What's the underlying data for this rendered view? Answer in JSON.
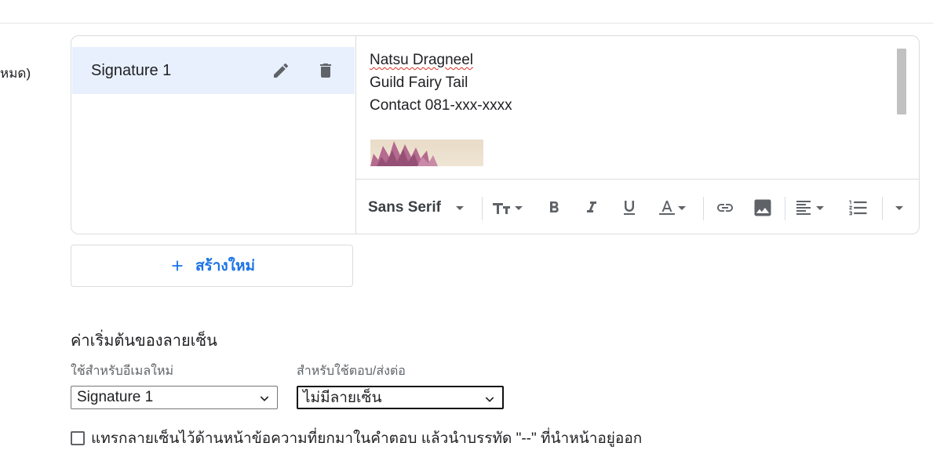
{
  "left_label": "หมด)",
  "signatures": {
    "items": [
      {
        "label": "Signature 1"
      }
    ],
    "edit_icon": "pencil-icon",
    "delete_icon": "trash-icon",
    "editor_lines": [
      "Natsu Dragneel",
      "Guild Fairy Tail",
      "Contact 081-xxx-xxxx"
    ]
  },
  "toolbar": {
    "font": "Sans Serif",
    "icons": [
      "text-size-icon",
      "bold-icon",
      "italic-icon",
      "underline-icon",
      "text-color-icon",
      "link-icon",
      "image-icon",
      "align-icon",
      "numbered-list-icon",
      "more-icon"
    ]
  },
  "create_button": {
    "label": "สร้างใหม่"
  },
  "defaults": {
    "title": "ค่าเริ่มต้นของลายเซ็น",
    "new_email_label": "ใช้สำหรับอีเมลใหม่",
    "new_email_value": "Signature 1",
    "reply_label": "สำหรับใช้ตอบ/ส่งต่อ",
    "reply_value": "ไม่มีลายเซ็น"
  },
  "checkbox": {
    "label": "แทรกลายเซ็นไว้ด้านหน้าข้อความที่ยกมาในคำตอบ แล้วนำบรรทัด \"--\" ที่นำหน้าอยู่ออก",
    "checked": false
  },
  "colors": {
    "accent": "#1a73e8",
    "selected_bg": "#e8f0fe",
    "border": "#dadce0"
  }
}
